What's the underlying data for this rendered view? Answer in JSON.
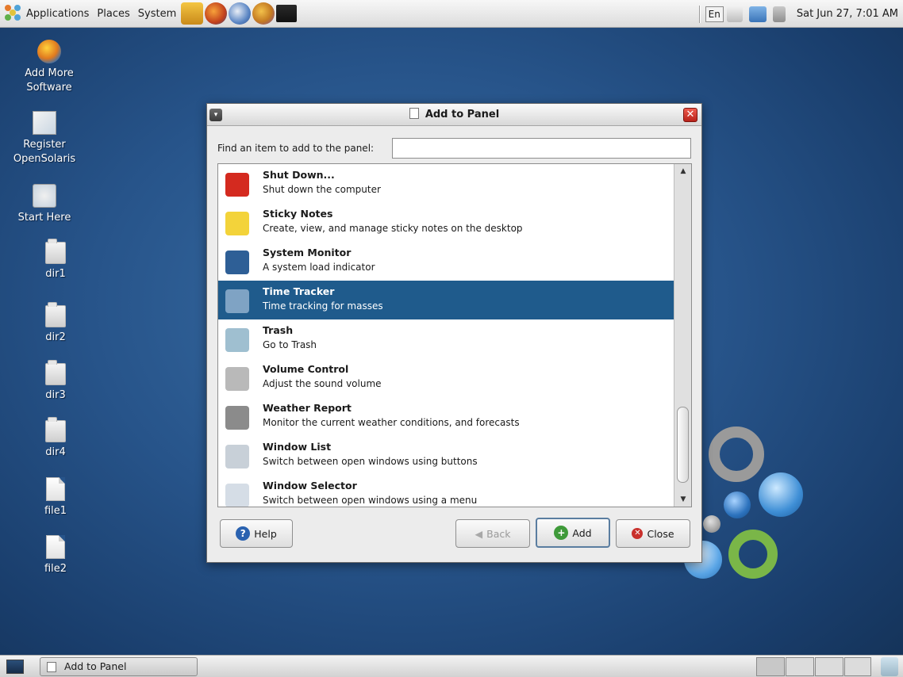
{
  "top_panel": {
    "menus": [
      "Applications",
      "Places",
      "System"
    ],
    "launchers": [
      "home-folder-icon",
      "firefox-icon",
      "thunderbird-icon",
      "pidgin-icon",
      "terminal-icon"
    ],
    "language": "En",
    "clock": "Sat Jun 27,  7:01 AM"
  },
  "desktop_icons": [
    {
      "label": "Add More\nSoftware",
      "icon": "package-manager-icon"
    },
    {
      "label": "Register\nOpenSolaris",
      "icon": "register-icon"
    },
    {
      "label": "Start Here",
      "icon": "start-here-icon"
    },
    {
      "label": "dir1",
      "icon": "folder-icon"
    },
    {
      "label": "dir2",
      "icon": "folder-icon"
    },
    {
      "label": "dir3",
      "icon": "folder-icon"
    },
    {
      "label": "dir4",
      "icon": "folder-icon"
    },
    {
      "label": "file1",
      "icon": "file-icon"
    },
    {
      "label": "file2",
      "icon": "file-icon"
    }
  ],
  "dialog": {
    "title": "Add to Panel",
    "find_label": "Find an item to add to the panel:",
    "find_value": "",
    "items": [
      {
        "name": "Shut Down...",
        "desc": "Shut down the computer",
        "icon": "power-icon",
        "color": "#d42a1f",
        "selected": false
      },
      {
        "name": "Sticky Notes",
        "desc": "Create, view, and manage sticky notes on the desktop",
        "icon": "sticky-note-icon",
        "color": "#f3d33a",
        "selected": false
      },
      {
        "name": "System Monitor",
        "desc": "A system load indicator",
        "icon": "system-monitor-icon",
        "color": "#2e5f96",
        "selected": false
      },
      {
        "name": "Time Tracker",
        "desc": "Time tracking for masses",
        "icon": "time-tracker-icon",
        "color": "#7fa3c4",
        "selected": true
      },
      {
        "name": "Trash",
        "desc": "Go to Trash",
        "icon": "trash-icon",
        "color": "#9fbfd0",
        "selected": false
      },
      {
        "name": "Volume Control",
        "desc": "Adjust the sound volume",
        "icon": "speaker-icon",
        "color": "#b9b9b9",
        "selected": false
      },
      {
        "name": "Weather Report",
        "desc": "Monitor the current weather conditions, and forecasts",
        "icon": "weather-icon",
        "color": "#8b8b8b",
        "selected": false
      },
      {
        "name": "Window List",
        "desc": "Switch between open windows using buttons",
        "icon": "window-list-icon",
        "color": "#c8d0d8",
        "selected": false
      },
      {
        "name": "Window Selector",
        "desc": "Switch between open windows using a menu",
        "icon": "window-selector-icon",
        "color": "#d5dde6",
        "selected": false
      }
    ],
    "buttons": {
      "help": "Help",
      "back": "Back",
      "add": "Add",
      "close": "Close"
    }
  },
  "bottom_panel": {
    "task_label": "Add to Panel"
  },
  "colors": {
    "selection": "#1f5b8c",
    "desktop": "#27548a"
  }
}
